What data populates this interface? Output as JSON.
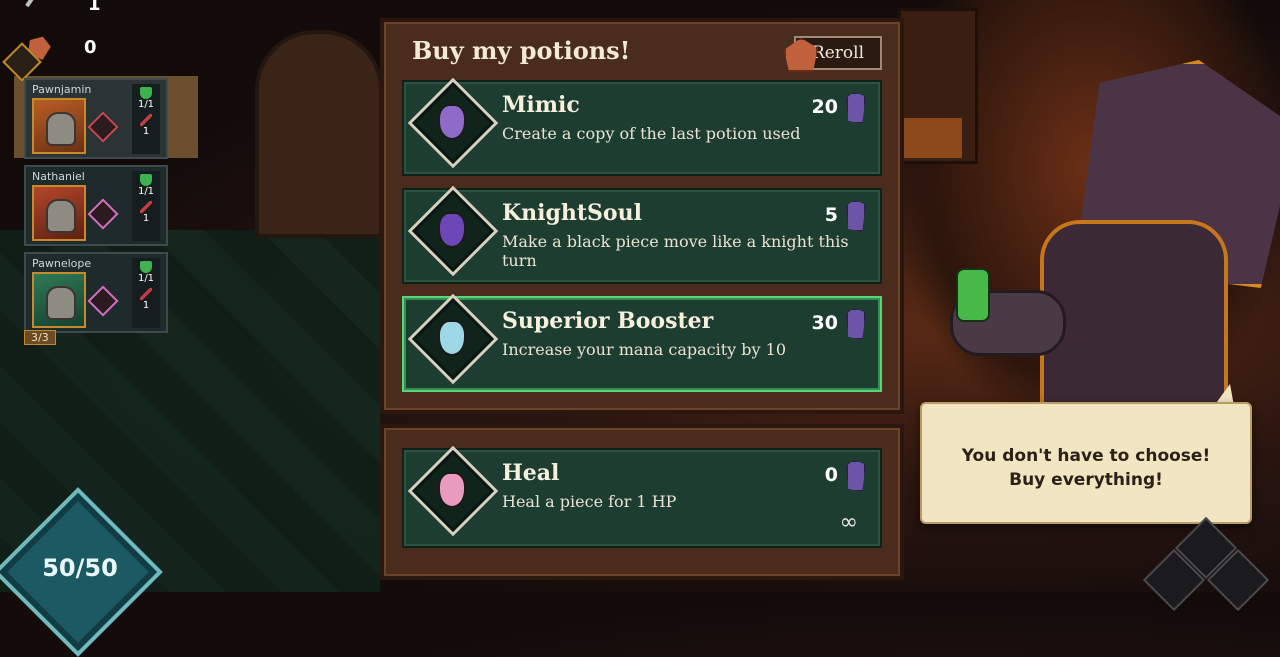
{
  "resources": {
    "swords": "1",
    "gems": "0"
  },
  "party": {
    "units": [
      {
        "name": "Pawnjamin",
        "hp": "1/1",
        "attack": "1"
      },
      {
        "name": "Nathaniel",
        "hp": "1/1",
        "attack": "1"
      },
      {
        "name": "Pawnelope",
        "hp": "1/1",
        "attack": "1"
      }
    ],
    "count": "3/3"
  },
  "mana": "50/50",
  "shop": {
    "title": "Buy my potions!",
    "reroll_label": "Reroll",
    "items": [
      {
        "name": "Mimic",
        "description": "Create a copy of the last potion used",
        "price": "20"
      },
      {
        "name": "KnightSoul",
        "description": "Make a black piece move like a knight this turn",
        "price": "5"
      },
      {
        "name": "Superior Booster",
        "description": "Increase your mana capacity by 10",
        "price": "30"
      }
    ],
    "heal": {
      "name": "Heal",
      "description": "Heal a piece for 1 HP",
      "price": "0",
      "stock": "∞"
    }
  },
  "merchant": {
    "speech_line1": "You don't have to choose!",
    "speech_line2": "Buy everything!"
  },
  "colors": {
    "selected_border": "#54d873",
    "panel_bg": "#4a2c1c",
    "item_bg": "#1e3d31",
    "mana_diamond": "#1c5a63"
  }
}
